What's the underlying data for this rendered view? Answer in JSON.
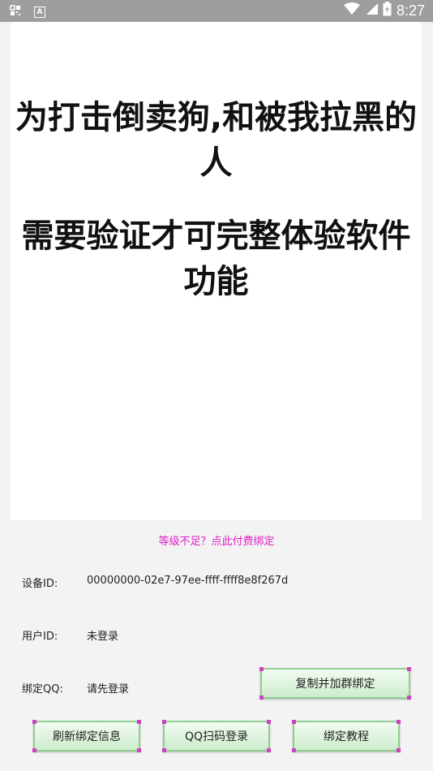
{
  "status_bar": {
    "time": "8:27"
  },
  "headline": {
    "line1": "为打击倒卖狗,和被我拉黑的人",
    "line2": "需要验证才可完整体验软件功能"
  },
  "upgrade_link": "等级不足？点此付费绑定",
  "device": {
    "label": "设备ID:",
    "value": "00000000-02e7-97ee-ffff-ffff8e8f267d"
  },
  "user": {
    "label": "用户ID:",
    "value": "未登录"
  },
  "qq": {
    "label": "绑定QQ:",
    "value": "请先登录"
  },
  "buttons": {
    "copy_join": "复制并加群绑定",
    "refresh": "刷新绑定信息",
    "qq_scan": "QQ扫码登录",
    "tutorial": "绑定教程"
  },
  "colors": {
    "accent_pink": "#e020c8",
    "button_green": "#cdeccd",
    "status_bar": "#9e9e9e"
  }
}
